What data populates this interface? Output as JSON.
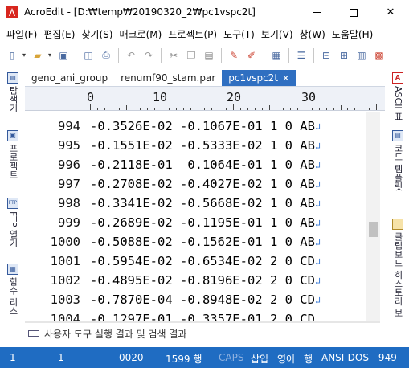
{
  "window": {
    "title": "AcroEdit - [D:₩temp₩20190320_2₩pc1vspc2t]"
  },
  "menu": [
    "파일(F)",
    "편집(E)",
    "찾기(S)",
    "매크로(M)",
    "프로젝트(P)",
    "도구(T)",
    "보기(V)",
    "창(W)",
    "도움말(H)"
  ],
  "left_panel": [
    {
      "label": "탐색기",
      "icon": "explorer-icon"
    },
    {
      "label": "프로젝트",
      "icon": "project-icon"
    },
    {
      "label": "FTP 열기",
      "icon": "ftp-icon",
      "badge": "FTP"
    },
    {
      "label": "함수 리스",
      "icon": "function-list-icon"
    }
  ],
  "right_panel": [
    {
      "label": "ASCII 표",
      "icon": "ascii-icon",
      "badge": "A"
    },
    {
      "label": "코드 템플릿",
      "icon": "code-template-icon"
    },
    {
      "label": "클립보드 히스토리 보",
      "icon": "clipboard-history-icon"
    }
  ],
  "tabs": [
    {
      "label": "geno_ani_group",
      "active": false
    },
    {
      "label": "renumf90_stam.par",
      "active": false
    },
    {
      "label": "pc1vspc2t",
      "active": true,
      "close": "✕"
    }
  ],
  "ruler": {
    "labels": [
      "0",
      "10",
      "20",
      "30"
    ]
  },
  "lines": [
    {
      "num": "994",
      "text": "-0.3526E-02 -0.1067E-01 1 0 AB"
    },
    {
      "num": "995",
      "text": "-0.1551E-02 -0.5333E-02 1 0 AB"
    },
    {
      "num": "996",
      "text": "-0.2118E-01  0.1064E-01 1 0 AB"
    },
    {
      "num": "997",
      "text": "-0.2708E-02 -0.4027E-02 1 0 AB"
    },
    {
      "num": "998",
      "text": "-0.3341E-02 -0.5668E-02 1 0 AB"
    },
    {
      "num": "999",
      "text": "-0.2689E-02 -0.1195E-01 1 0 AB"
    },
    {
      "num": "1000",
      "text": "-0.5088E-02 -0.1562E-01 1 0 AB"
    },
    {
      "num": "1001",
      "text": "-0.5954E-02 -0.6534E-02 2 0 CD"
    },
    {
      "num": "1002",
      "text": "-0.4895E-02 -0.8196E-02 2 0 CD"
    },
    {
      "num": "1003",
      "text": "-0.7870E-04 -0.8948E-02 2 0 CD"
    },
    {
      "num": "1004",
      "text": "-0.1297E-01 -0.3357E-01 2 0 CD"
    }
  ],
  "eol_glyph": "↲",
  "output_panel": {
    "label": "사용자 도구 실행 결과 및 검색 결과"
  },
  "status": {
    "col": "1",
    "col2": "1",
    "char_code": "0020",
    "line_info": "1599 행",
    "caps": "CAPS",
    "insert_mode": "삽입",
    "lang": "영어",
    "line_mode": "행",
    "encoding": "ANSI-DOS - 949"
  },
  "colors": {
    "accent": "#1f6cc2",
    "active_tab": "#2f6fc1",
    "eol_marker": "#3c7bd5"
  }
}
